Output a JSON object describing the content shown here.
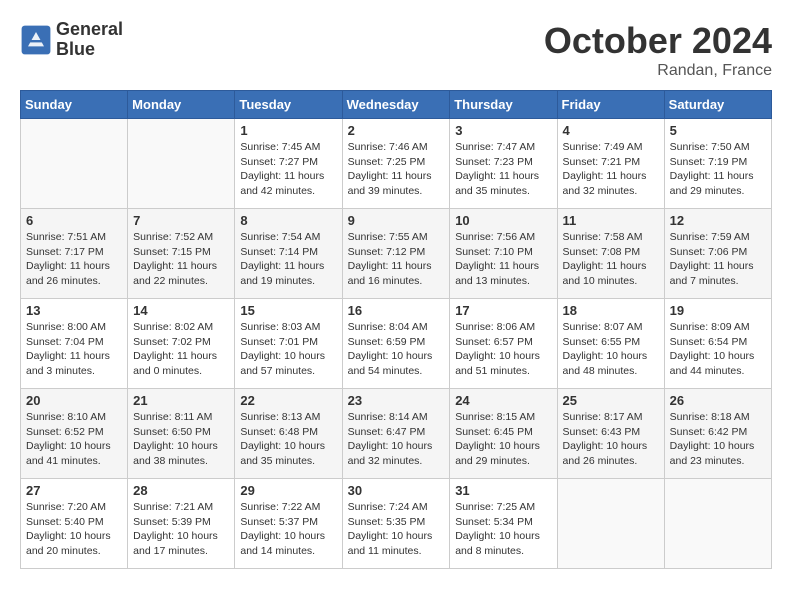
{
  "header": {
    "logo_line1": "General",
    "logo_line2": "Blue",
    "month": "October 2024",
    "location": "Randan, France"
  },
  "weekdays": [
    "Sunday",
    "Monday",
    "Tuesday",
    "Wednesday",
    "Thursday",
    "Friday",
    "Saturday"
  ],
  "weeks": [
    [
      {
        "day": "",
        "info": ""
      },
      {
        "day": "",
        "info": ""
      },
      {
        "day": "1",
        "info": "Sunrise: 7:45 AM\nSunset: 7:27 PM\nDaylight: 11 hours and 42 minutes."
      },
      {
        "day": "2",
        "info": "Sunrise: 7:46 AM\nSunset: 7:25 PM\nDaylight: 11 hours and 39 minutes."
      },
      {
        "day": "3",
        "info": "Sunrise: 7:47 AM\nSunset: 7:23 PM\nDaylight: 11 hours and 35 minutes."
      },
      {
        "day": "4",
        "info": "Sunrise: 7:49 AM\nSunset: 7:21 PM\nDaylight: 11 hours and 32 minutes."
      },
      {
        "day": "5",
        "info": "Sunrise: 7:50 AM\nSunset: 7:19 PM\nDaylight: 11 hours and 29 minutes."
      }
    ],
    [
      {
        "day": "6",
        "info": "Sunrise: 7:51 AM\nSunset: 7:17 PM\nDaylight: 11 hours and 26 minutes."
      },
      {
        "day": "7",
        "info": "Sunrise: 7:52 AM\nSunset: 7:15 PM\nDaylight: 11 hours and 22 minutes."
      },
      {
        "day": "8",
        "info": "Sunrise: 7:54 AM\nSunset: 7:14 PM\nDaylight: 11 hours and 19 minutes."
      },
      {
        "day": "9",
        "info": "Sunrise: 7:55 AM\nSunset: 7:12 PM\nDaylight: 11 hours and 16 minutes."
      },
      {
        "day": "10",
        "info": "Sunrise: 7:56 AM\nSunset: 7:10 PM\nDaylight: 11 hours and 13 minutes."
      },
      {
        "day": "11",
        "info": "Sunrise: 7:58 AM\nSunset: 7:08 PM\nDaylight: 11 hours and 10 minutes."
      },
      {
        "day": "12",
        "info": "Sunrise: 7:59 AM\nSunset: 7:06 PM\nDaylight: 11 hours and 7 minutes."
      }
    ],
    [
      {
        "day": "13",
        "info": "Sunrise: 8:00 AM\nSunset: 7:04 PM\nDaylight: 11 hours and 3 minutes."
      },
      {
        "day": "14",
        "info": "Sunrise: 8:02 AM\nSunset: 7:02 PM\nDaylight: 11 hours and 0 minutes."
      },
      {
        "day": "15",
        "info": "Sunrise: 8:03 AM\nSunset: 7:01 PM\nDaylight: 10 hours and 57 minutes."
      },
      {
        "day": "16",
        "info": "Sunrise: 8:04 AM\nSunset: 6:59 PM\nDaylight: 10 hours and 54 minutes."
      },
      {
        "day": "17",
        "info": "Sunrise: 8:06 AM\nSunset: 6:57 PM\nDaylight: 10 hours and 51 minutes."
      },
      {
        "day": "18",
        "info": "Sunrise: 8:07 AM\nSunset: 6:55 PM\nDaylight: 10 hours and 48 minutes."
      },
      {
        "day": "19",
        "info": "Sunrise: 8:09 AM\nSunset: 6:54 PM\nDaylight: 10 hours and 44 minutes."
      }
    ],
    [
      {
        "day": "20",
        "info": "Sunrise: 8:10 AM\nSunset: 6:52 PM\nDaylight: 10 hours and 41 minutes."
      },
      {
        "day": "21",
        "info": "Sunrise: 8:11 AM\nSunset: 6:50 PM\nDaylight: 10 hours and 38 minutes."
      },
      {
        "day": "22",
        "info": "Sunrise: 8:13 AM\nSunset: 6:48 PM\nDaylight: 10 hours and 35 minutes."
      },
      {
        "day": "23",
        "info": "Sunrise: 8:14 AM\nSunset: 6:47 PM\nDaylight: 10 hours and 32 minutes."
      },
      {
        "day": "24",
        "info": "Sunrise: 8:15 AM\nSunset: 6:45 PM\nDaylight: 10 hours and 29 minutes."
      },
      {
        "day": "25",
        "info": "Sunrise: 8:17 AM\nSunset: 6:43 PM\nDaylight: 10 hours and 26 minutes."
      },
      {
        "day": "26",
        "info": "Sunrise: 8:18 AM\nSunset: 6:42 PM\nDaylight: 10 hours and 23 minutes."
      }
    ],
    [
      {
        "day": "27",
        "info": "Sunrise: 7:20 AM\nSunset: 5:40 PM\nDaylight: 10 hours and 20 minutes."
      },
      {
        "day": "28",
        "info": "Sunrise: 7:21 AM\nSunset: 5:39 PM\nDaylight: 10 hours and 17 minutes."
      },
      {
        "day": "29",
        "info": "Sunrise: 7:22 AM\nSunset: 5:37 PM\nDaylight: 10 hours and 14 minutes."
      },
      {
        "day": "30",
        "info": "Sunrise: 7:24 AM\nSunset: 5:35 PM\nDaylight: 10 hours and 11 minutes."
      },
      {
        "day": "31",
        "info": "Sunrise: 7:25 AM\nSunset: 5:34 PM\nDaylight: 10 hours and 8 minutes."
      },
      {
        "day": "",
        "info": ""
      },
      {
        "day": "",
        "info": ""
      }
    ]
  ]
}
